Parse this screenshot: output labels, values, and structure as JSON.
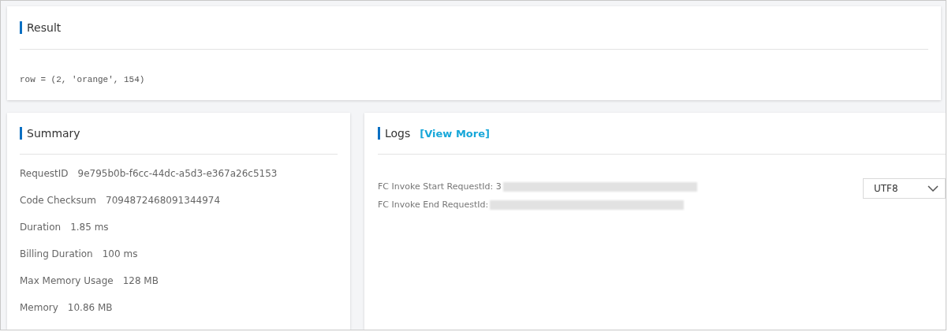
{
  "result": {
    "title": "Result",
    "output": "row = (2, 'orange', 154)"
  },
  "summary": {
    "title": "Summary",
    "rows": [
      {
        "label": "RequestID",
        "value": "9e795b0b-f6cc-44dc-a5d3-e367a26c5153"
      },
      {
        "label": "Code Checksum",
        "value": "7094872468091344974"
      },
      {
        "label": "Duration",
        "value": "1.85 ms"
      },
      {
        "label": "Billing Duration",
        "value": "100 ms"
      },
      {
        "label": "Max Memory Usage",
        "value": "128 MB"
      },
      {
        "label": "Memory",
        "value": "10.86 MB"
      }
    ]
  },
  "logs": {
    "title": "Logs",
    "link": "[View More]",
    "lines": [
      {
        "text": "FC Invoke Start RequestId: 3"
      },
      {
        "text": "FC Invoke End RequestId:"
      }
    ],
    "encoding": "UTF8"
  }
}
